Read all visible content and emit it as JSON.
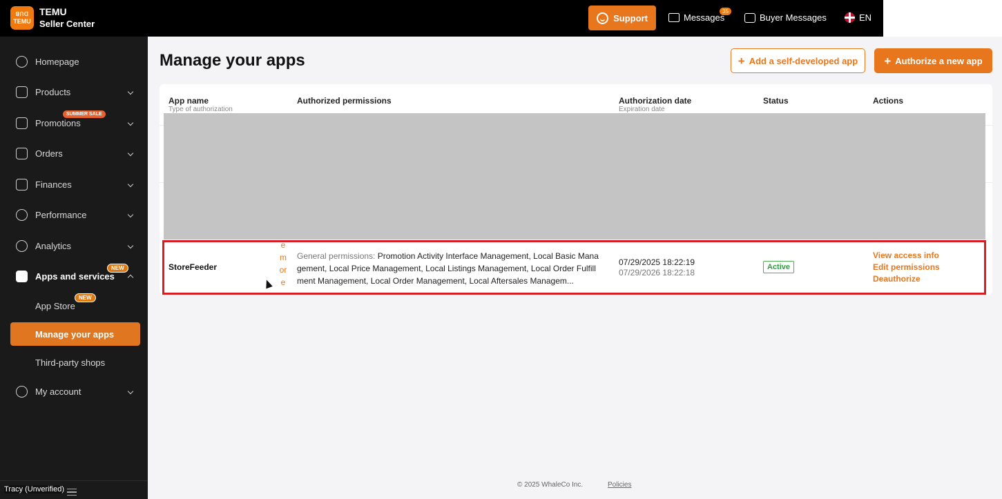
{
  "header": {
    "brand_line1": "TEMU",
    "brand_line2": "Seller Center",
    "logo_top": "ꓭꓵꓷ",
    "logo_text": "TEMU",
    "support_label": "Support",
    "messages_label": "Messages",
    "messages_count": "35",
    "buyer_messages_label": "Buyer Messages",
    "language": "EN"
  },
  "sidebar": {
    "items": [
      {
        "label": "Homepage",
        "icon": "home-icon"
      },
      {
        "label": "Products",
        "icon": "bag-icon"
      },
      {
        "label": "Promotions",
        "icon": "ticket-icon",
        "tag": "SUMMER SALE"
      },
      {
        "label": "Orders",
        "icon": "orders-icon"
      },
      {
        "label": "Finances",
        "icon": "dollar-icon"
      },
      {
        "label": "Performance",
        "icon": "performance-icon"
      },
      {
        "label": "Analytics",
        "icon": "pie-icon"
      },
      {
        "label": "Apps and services",
        "icon": "cube-icon",
        "tag": "NEW"
      },
      {
        "label": "My account",
        "icon": "user-icon"
      }
    ],
    "sub_items": {
      "app_store": "App Store",
      "app_store_tag": "NEW",
      "manage_apps": "Manage your apps",
      "third_party": "Third-party shops"
    },
    "user": "Tracy (Unverified)"
  },
  "main": {
    "title": "Manage your apps",
    "add_self_developed": "Add a self-developed app",
    "authorize_new": "Authorize a new app",
    "table": {
      "col_app_name": "App name",
      "col_app_name_sub": "Type of authorization",
      "col_permissions": "Authorized permissions",
      "col_auth_date": "Authorization date",
      "col_auth_date_sub": "Expiration date",
      "col_status": "Status",
      "col_actions": "Actions",
      "row": {
        "app_name": "StoreFeeder",
        "more_text": "e m or e",
        "perm_prefix": "General permissions: ",
        "permissions": "Promotion Activity Interface Management, Local Basic Management, Local Price Management, Local Listings Management, Local Order Fulfillment Management, Local Order Management, Local Aftersales Managem...",
        "auth_date": "07/29/2025 18:22:19",
        "exp_date": "07/29/2026 18:22:18",
        "status": "Active",
        "action_view": "View access info",
        "action_edit": "Edit permissions",
        "action_deauth": "Deauthorize"
      }
    }
  },
  "footer": {
    "copyright": "© 2025 WhaleCo Inc.",
    "policies": "Policies"
  },
  "colors": {
    "accent": "#e8761c",
    "highlight_border": "#d81e24",
    "status_green": "#2e9b3e"
  }
}
